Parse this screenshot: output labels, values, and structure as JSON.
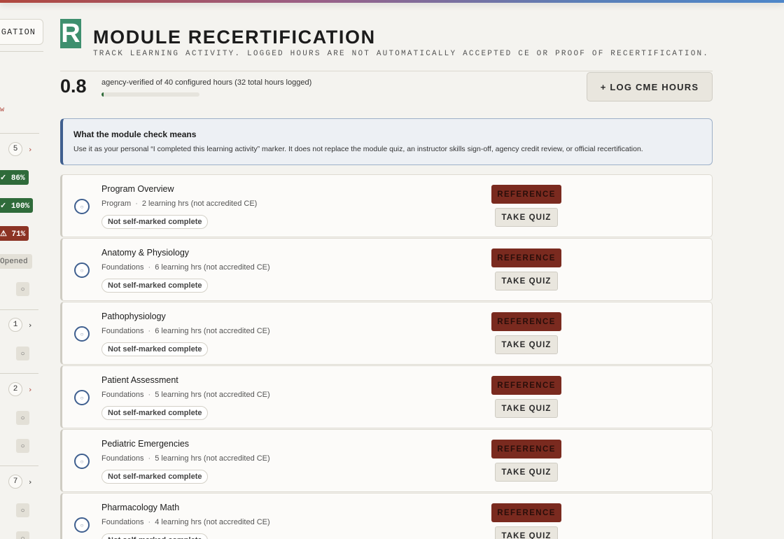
{
  "sidebar": {
    "nav_label": "IGATION",
    "red_note": "w",
    "counts": [
      "5",
      "1",
      "2",
      "7"
    ],
    "badges": [
      {
        "text": "✓ 86%",
        "color": "#2f6b3a"
      },
      {
        "text": "✓ 100%",
        "color": "#2f6b3a"
      },
      {
        "text": "⚠ 71%",
        "color": "#8c3324"
      }
    ],
    "opened_label": "Opened",
    "chip_glyph": "○"
  },
  "header": {
    "logo_letter": "R",
    "title": "MODULE RECERTIFICATION",
    "subtitle": "TRACK LEARNING ACTIVITY. LOGGED HOURS ARE NOT AUTOMATICALLY ACCEPTED CE OR PROOF OF RECERTIFICATION."
  },
  "stats": {
    "verified_hours": "0.8",
    "description": "agency-verified of 40 configured hours (32 total hours logged)",
    "progress_fraction": 0.02,
    "log_button": "+ LOG CME HOURS"
  },
  "info": {
    "title": "What the module check means",
    "body": "Use it as your personal “I completed this learning activity” marker. It does not replace the module quiz, an instructor skills sign-off, agency credit review, or official recertification."
  },
  "modules": [
    {
      "name": "Program Overview",
      "category": "Program",
      "hours": "2 learning hrs (not accredited CE)",
      "status": "Not self-marked complete",
      "reference": "REFERENCE",
      "quiz": "TAKE QUIZ"
    },
    {
      "name": "Anatomy & Physiology",
      "category": "Foundations",
      "hours": "6 learning hrs (not accredited CE)",
      "status": "Not self-marked complete",
      "reference": "REFERENCE",
      "quiz": "TAKE QUIZ"
    },
    {
      "name": "Pathophysiology",
      "category": "Foundations",
      "hours": "6 learning hrs (not accredited CE)",
      "status": "Not self-marked complete",
      "reference": "REFERENCE",
      "quiz": "TAKE QUIZ"
    },
    {
      "name": "Patient Assessment",
      "category": "Foundations",
      "hours": "5 learning hrs (not accredited CE)",
      "status": "Not self-marked complete",
      "reference": "REFERENCE",
      "quiz": "TAKE QUIZ"
    },
    {
      "name": "Pediatric Emergencies",
      "category": "Foundations",
      "hours": "5 learning hrs (not accredited CE)",
      "status": "Not self-marked complete",
      "reference": "REFERENCE",
      "quiz": "TAKE QUIZ"
    },
    {
      "name": "Pharmacology Math",
      "category": "Foundations",
      "hours": "4 learning hrs (not accredited CE)",
      "status": "Not self-marked complete",
      "reference": "REFERENCE",
      "quiz": "TAKE QUIZ"
    }
  ],
  "meta_separator": "·",
  "check_glyph": "○"
}
